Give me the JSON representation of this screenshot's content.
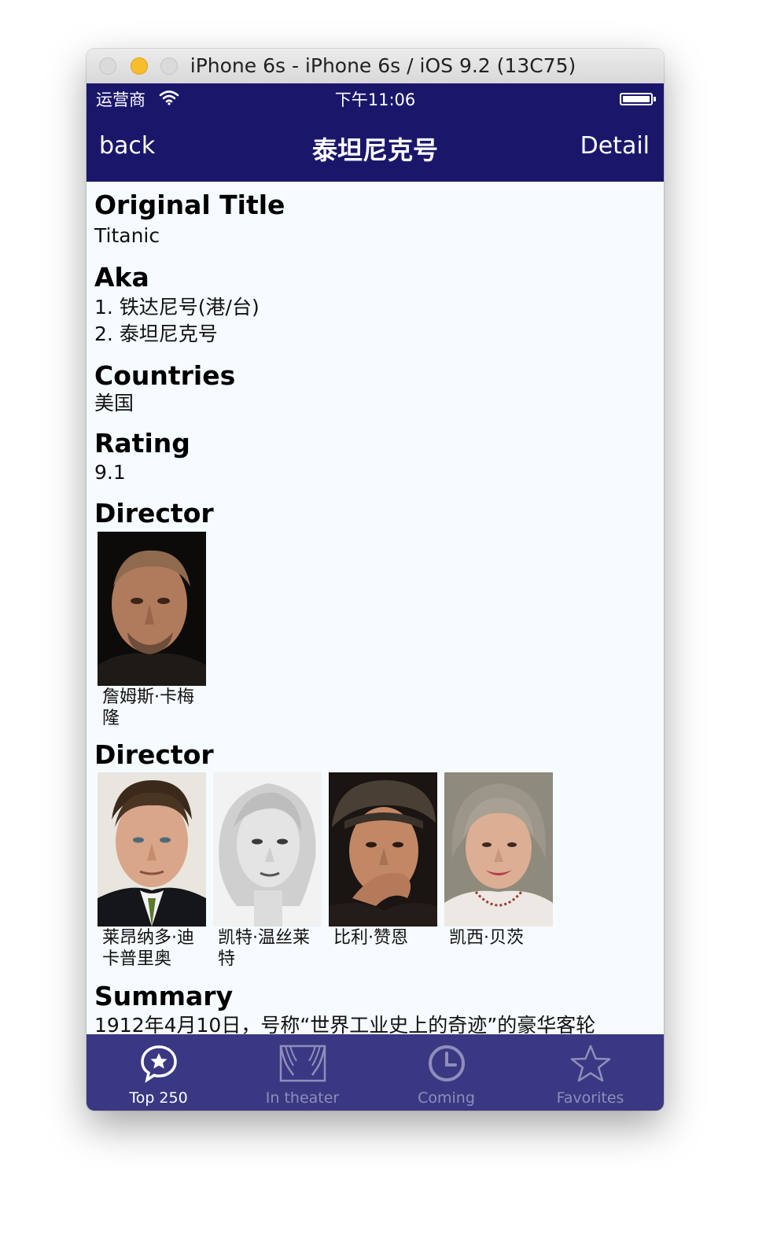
{
  "window": {
    "title": "iPhone 6s - iPhone 6s / iOS 9.2 (13C75)"
  },
  "status_bar": {
    "carrier": "运营商",
    "time": "下午11:06"
  },
  "nav": {
    "back_label": "back",
    "title": "泰坦尼克号",
    "detail_label": "Detail"
  },
  "sections": {
    "original_title": {
      "heading": "Original Title",
      "value": "Titanic"
    },
    "aka": {
      "heading": "Aka",
      "items": [
        "1. 铁达尼号(港/台)",
        "2. 泰坦尼克号"
      ]
    },
    "countries": {
      "heading": "Countries",
      "value": "美国"
    },
    "rating": {
      "heading": "Rating",
      "value": "9.1"
    },
    "director": {
      "heading": "Director",
      "people": [
        {
          "name": "詹姆斯·卡梅隆"
        }
      ]
    },
    "cast": {
      "heading": "Director",
      "people": [
        {
          "name": "莱昂纳多·迪卡普里奥"
        },
        {
          "name": "凯特·温丝莱特"
        },
        {
          "name": "比利·赞恩"
        },
        {
          "name": "凯西·贝茨"
        }
      ]
    },
    "summary": {
      "heading": "Summary",
      "text": "1912年4月10日，号称“世界工业史上的奇迹”的豪华客轮"
    }
  },
  "tabs": [
    {
      "label": "Top 250",
      "icon": "chat-star-icon",
      "active": true
    },
    {
      "label": "In theater",
      "icon": "theater-icon",
      "active": false
    },
    {
      "label": "Coming",
      "icon": "clock-icon",
      "active": false
    },
    {
      "label": "Favorites",
      "icon": "star-icon",
      "active": false
    }
  ],
  "colors": {
    "nav_bg": "#1a176b",
    "tabbar_bg": "#3a3882",
    "content_bg": "#f5fbff",
    "tab_active": "#ffffff",
    "tab_inactive": "#8f8dbb"
  }
}
